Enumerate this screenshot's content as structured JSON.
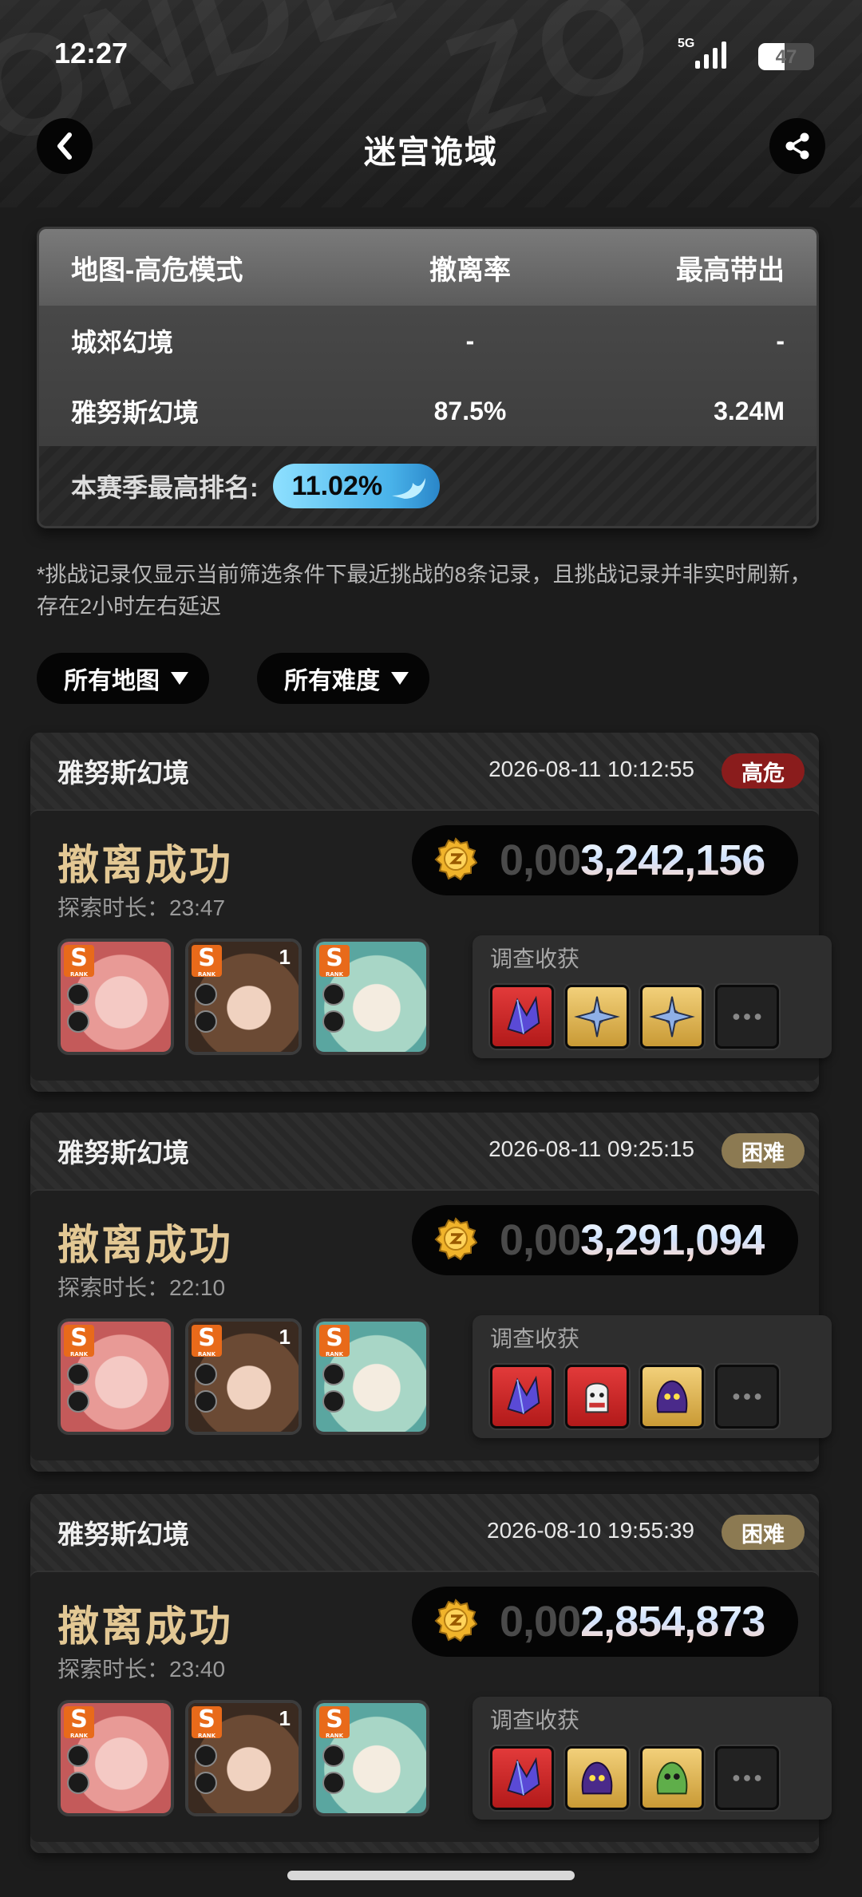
{
  "status_bar": {
    "time": "12:27",
    "network": "5G",
    "battery": "47"
  },
  "header": {
    "title": "迷宫诡域",
    "back_icon": "chevron-left-icon",
    "share_icon": "share-icon"
  },
  "summary": {
    "headers": [
      "地图-高危模式",
      "撤离率",
      "最高带出"
    ],
    "rows": [
      {
        "map": "城郊幻境",
        "rate": "-",
        "max": "-"
      },
      {
        "map": "雅努斯幻境",
        "rate": "87.5%",
        "max": "3.24M"
      }
    ],
    "rank_label": "本赛季最高排名:",
    "rank_value": "11.02%"
  },
  "note": "*挑战记录仅显示当前筛选条件下最近挑战的8条记录，且挑战记录并非实时刷新，存在2小时左右延迟",
  "filters": {
    "map": "所有地图",
    "difficulty": "所有难度"
  },
  "records": [
    {
      "map": "雅努斯幻境",
      "datetime": "2026-08-11 10:12:55",
      "difficulty": "高危",
      "difficulty_color": "#8a1c1c",
      "result": "撤离成功",
      "duration": "探索时长：23:47",
      "coins_prefix": "0,00",
      "coins": "3,242,156",
      "loot_label": "调查收获",
      "characters": [
        {
          "rank": "S",
          "level": ""
        },
        {
          "rank": "S",
          "level": "1"
        },
        {
          "rank": "S",
          "level": ""
        }
      ],
      "loot": [
        "crystal-shard-icon",
        "gear-star-icon",
        "gear-star-icon",
        "more-icon"
      ]
    },
    {
      "map": "雅努斯幻境",
      "datetime": "2026-08-11 09:25:15",
      "difficulty": "困难",
      "difficulty_color": "#8c7a52",
      "result": "撤离成功",
      "duration": "探索时长：22:10",
      "coins_prefix": "0,00",
      "coins": "3,291,094",
      "loot_label": "调查收获",
      "characters": [
        {
          "rank": "S",
          "level": ""
        },
        {
          "rank": "S",
          "level": "1"
        },
        {
          "rank": "S",
          "level": ""
        }
      ],
      "loot": [
        "crystal-shard-icon",
        "ghost-bag-icon",
        "purple-blob-icon",
        "more-icon"
      ]
    },
    {
      "map": "雅努斯幻境",
      "datetime": "2026-08-10 19:55:39",
      "difficulty": "困难",
      "difficulty_color": "#8c7a52",
      "result": "撤离成功",
      "duration": "探索时长：23:40",
      "coins_prefix": "0,00",
      "coins": "2,854,873",
      "loot_label": "调查收获",
      "characters": [
        {
          "rank": "S",
          "level": ""
        },
        {
          "rank": "S",
          "level": "1"
        },
        {
          "rank": "S",
          "level": ""
        }
      ],
      "loot": [
        "crystal-shard-icon",
        "purple-blob-icon",
        "green-blob-icon",
        "more-icon"
      ]
    }
  ]
}
